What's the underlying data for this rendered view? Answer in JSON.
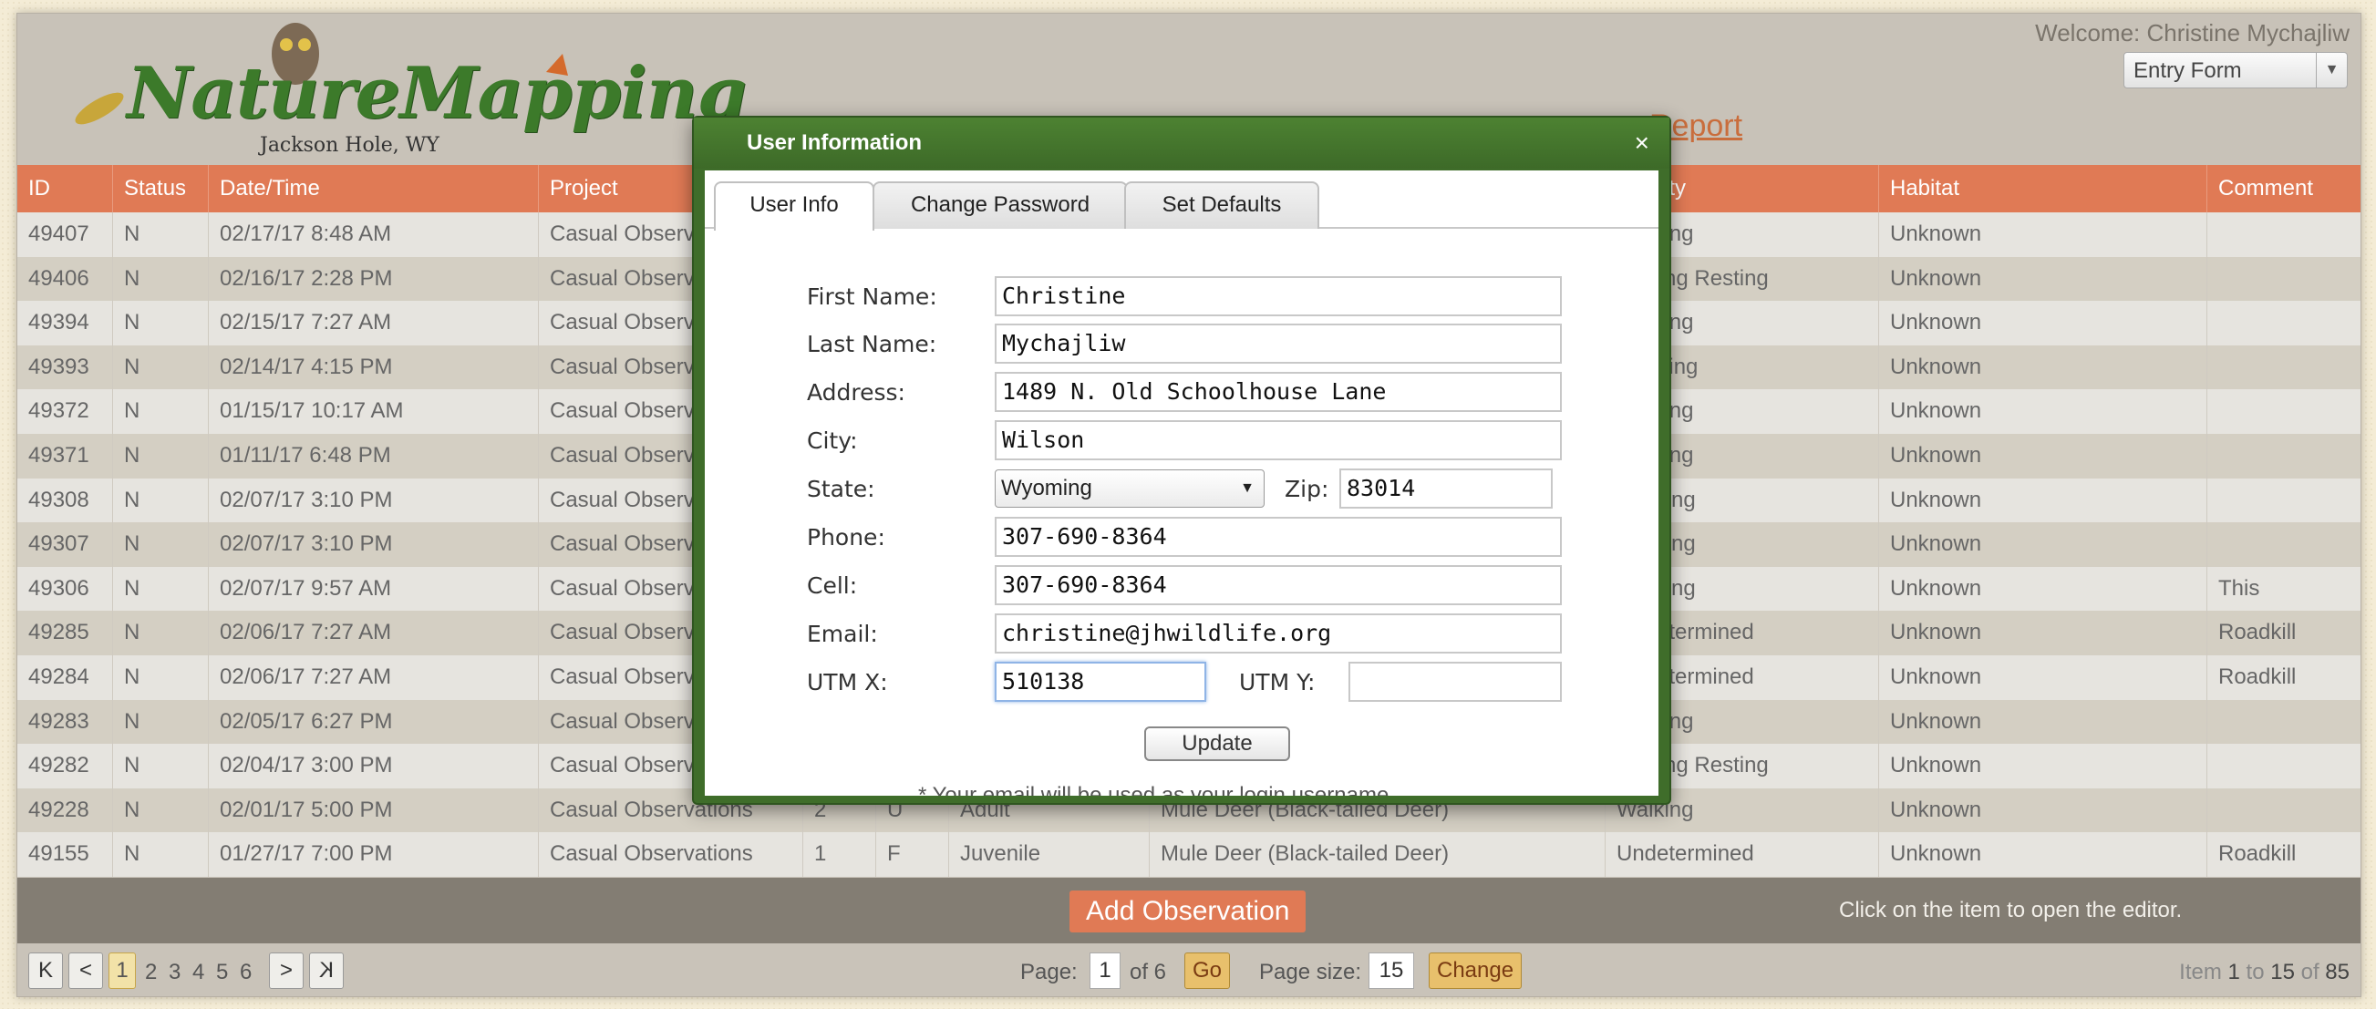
{
  "header": {
    "logo_title": "NatureMapping",
    "logo_subtitle": "Jackson Hole, WY",
    "welcome": "Welcome: Christine Mychajliw",
    "form_select": "Entry Form",
    "report_link": "Report"
  },
  "grid": {
    "columns": [
      "ID",
      "Status",
      "Date/Time",
      "Project",
      "",
      "",
      "",
      "",
      "Activity",
      "Habitat",
      "Comment"
    ],
    "rows": [
      [
        "49407",
        "N",
        "02/17/17 8:48 AM",
        "Casual Observations",
        "",
        "",
        "",
        "",
        "Walking",
        "Unknown",
        ""
      ],
      [
        "49406",
        "N",
        "02/16/17 2:28 PM",
        "Casual Observations",
        "",
        "",
        "",
        "",
        "Loafing Resting",
        "Unknown",
        ""
      ],
      [
        "49394",
        "N",
        "02/15/17 7:27 AM",
        "Casual Observations",
        "",
        "",
        "",
        "",
        "Walking",
        "Unknown",
        ""
      ],
      [
        "49393",
        "N",
        "02/14/17 4:15 PM",
        "Casual Observations",
        "",
        "",
        "",
        "",
        "Running",
        "Unknown",
        ""
      ],
      [
        "49372",
        "N",
        "01/15/17 10:17 AM",
        "Casual Observations",
        "",
        "",
        "",
        "",
        "Walking",
        "Unknown",
        ""
      ],
      [
        "49371",
        "N",
        "01/11/17 6:48 PM",
        "Casual Observations",
        "",
        "",
        "",
        "",
        "Walking",
        "Unknown",
        ""
      ],
      [
        "49308",
        "N",
        "02/07/17 3:10 PM",
        "Casual Observations",
        "",
        "",
        "",
        "",
        "Feeding",
        "Unknown",
        ""
      ],
      [
        "49307",
        "N",
        "02/07/17 3:10 PM",
        "Casual Observations",
        "",
        "",
        "",
        "",
        "Feeding",
        "Unknown",
        ""
      ],
      [
        "49306",
        "N",
        "02/07/17 9:57 AM",
        "Casual Observations",
        "",
        "",
        "",
        "",
        "Feeding",
        "Unknown",
        "This"
      ],
      [
        "49285",
        "N",
        "02/06/17 7:27 AM",
        "Casual Observations",
        "",
        "",
        "",
        "",
        "Undetermined",
        "Unknown",
        "Roadkill"
      ],
      [
        "49284",
        "N",
        "02/06/17 7:27 AM",
        "Casual Observations",
        "",
        "",
        "",
        "",
        "Undetermined",
        "Unknown",
        "Roadkill"
      ],
      [
        "49283",
        "N",
        "02/05/17 6:27 PM",
        "Casual Observations",
        "",
        "",
        "",
        "",
        "Walking",
        "Unknown",
        ""
      ],
      [
        "49282",
        "N",
        "02/04/17 3:00 PM",
        "Casual Observations",
        "",
        "",
        "",
        "",
        "Loafing Resting",
        "Unknown",
        ""
      ],
      [
        "49228",
        "N",
        "02/01/17 5:00 PM",
        "Casual Observations",
        "2",
        "U",
        "Adult",
        "Mule Deer (Black-tailed Deer)",
        "Walking",
        "Unknown",
        ""
      ],
      [
        "49155",
        "N",
        "01/27/17 7:00 PM",
        "Casual Observations",
        "1",
        "F",
        "Juvenile",
        "Mule Deer (Black-tailed Deer)",
        "Undetermined",
        "Unknown",
        "Roadkill"
      ]
    ]
  },
  "actions": {
    "add_label": "Add Observation",
    "hint": "Click on the item to open the editor."
  },
  "pager": {
    "first": "K",
    "prev": "<",
    "pages": [
      "1",
      "2",
      "3",
      "4",
      "5",
      "6"
    ],
    "next": ">",
    "last": "K",
    "page_label": "Page:",
    "page_value": "1",
    "of_label": "of 6",
    "go": "Go",
    "size_label": "Page size:",
    "size_value": "15",
    "change": "Change",
    "item_prefix": "Item",
    "item_from": "1",
    "item_to_label": "to",
    "item_to": "15",
    "item_of_label": "of",
    "item_total": "85"
  },
  "modal": {
    "title": "User Information",
    "close": "×",
    "tabs": [
      "User Info",
      "Change Password",
      "Set Defaults"
    ],
    "labels": {
      "first_name": "First Name:",
      "last_name": "Last Name:",
      "address": "Address:",
      "city": "City:",
      "state": "State:",
      "zip": "Zip:",
      "phone": "Phone:",
      "cell": "Cell:",
      "email": "Email:",
      "utm_x": "UTM X:",
      "utm_y": "UTM Y:"
    },
    "values": {
      "first_name": "Christine",
      "last_name": "Mychajliw",
      "address": "1489 N. Old Schoolhouse Lane",
      "city": "Wilson",
      "state": "Wyoming",
      "zip": "83014",
      "phone": "307-690-8364",
      "cell": "307-690-8364",
      "email": "christine@jhwildlife.org",
      "utm_x": "510138",
      "utm_y": ""
    },
    "update": "Update",
    "note": "* Your email will be used as your login username."
  },
  "colors": {
    "grid_header": "#e07a55",
    "modal_green": "#3f6d2a",
    "logo_green": "#3c7a2a"
  }
}
